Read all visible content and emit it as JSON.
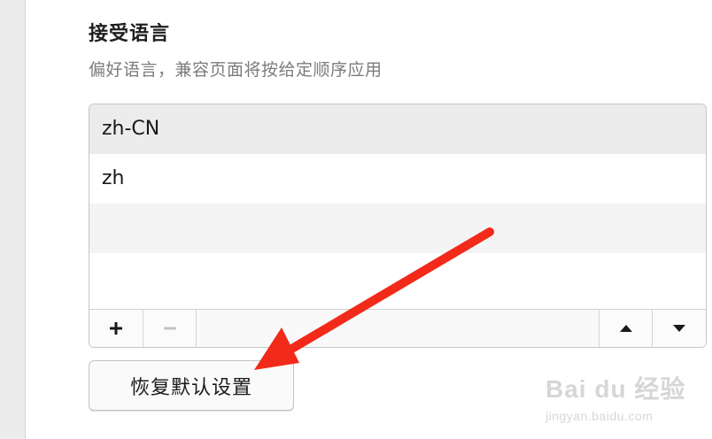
{
  "section": {
    "title": "接受语言",
    "description": "偏好语言，兼容页面将按给定顺序应用"
  },
  "languages": {
    "items": [
      {
        "label": "zh-CN",
        "selected": true
      },
      {
        "label": "zh",
        "selected": false
      },
      {
        "label": "",
        "selected": false
      },
      {
        "label": "",
        "selected": false
      }
    ]
  },
  "toolbar": {
    "add_icon": "plus-icon",
    "remove_icon": "minus-icon",
    "move_up_icon": "triangle-up-icon",
    "move_down_icon": "triangle-down-icon"
  },
  "reset_button": {
    "label": "恢复默认设置"
  },
  "annotation": {
    "arrow_color": "#f22a1a"
  },
  "watermark": {
    "brand": "Bai du 经验",
    "url": "jingyan.baidu.com"
  }
}
